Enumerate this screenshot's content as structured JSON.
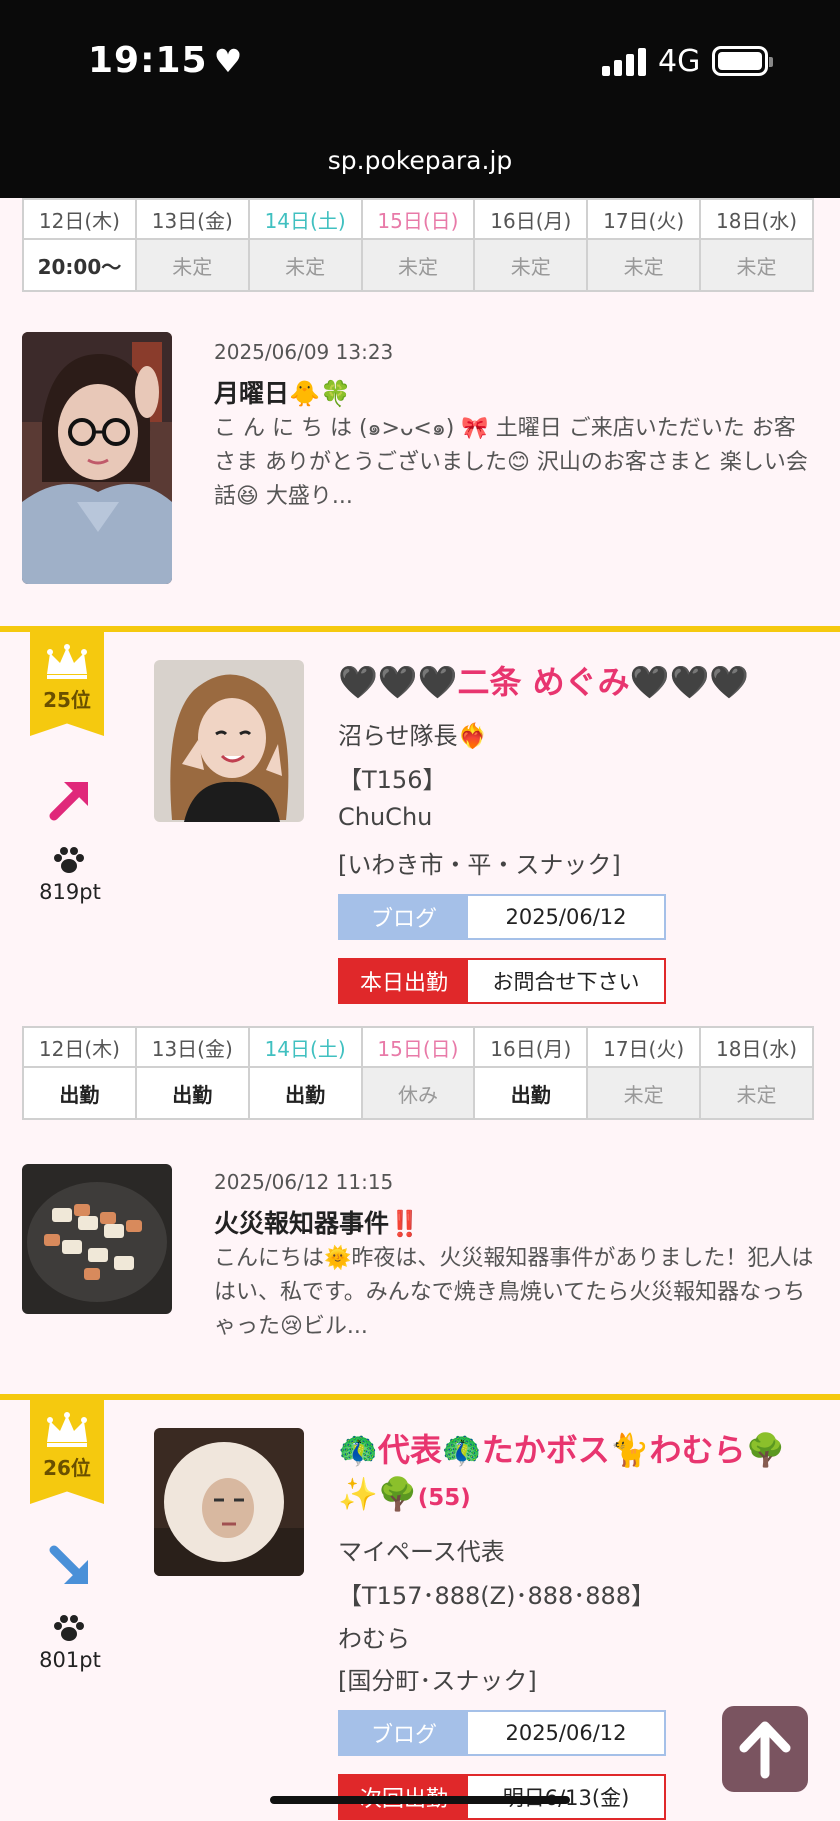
{
  "status_bar": {
    "time": "19:15",
    "network": "4G",
    "url": "sp.pokepara.jp"
  },
  "days": [
    {
      "label": "12日(木)",
      "kind": "wd"
    },
    {
      "label": "13日(金)",
      "kind": "wd"
    },
    {
      "label": "14日(土)",
      "kind": "sat"
    },
    {
      "label": "15日(日)",
      "kind": "sun"
    },
    {
      "label": "16日(月)",
      "kind": "wd"
    },
    {
      "label": "17日(火)",
      "kind": "wd"
    },
    {
      "label": "18日(水)",
      "kind": "wd"
    }
  ],
  "schedule_top": [
    "20:00〜",
    "未定",
    "未定",
    "未定",
    "未定",
    "未定",
    "未定"
  ],
  "blog1": {
    "date": "2025/06/09 13:23",
    "title": "月曜日🐥🍀",
    "excerpt": "こ ん に ち は (๑>ᴗ<๑) 🎀 土曜日 ご来店いただいた お客さま ありがとうございました😊 沢山のお客さまと 楽しい会話😆 大盛り..."
  },
  "cast1": {
    "rank": "25位",
    "trend": "up",
    "points": "819pt",
    "name_prefix": "🖤🖤🖤",
    "name": "二条 めぐみ",
    "name_suffix": "🖤🖤🖤",
    "catch": "沼らせ隊長❤️‍🔥",
    "spec": "【T156】",
    "shop": "ChuChu",
    "area": "[いわき市・平・スナック]",
    "blog_label": "ブログ",
    "blog_date": "2025/06/12",
    "attend_label": "本日出勤",
    "attend_value": "お問合せ下さい",
    "schedule": [
      "出勤",
      "出勤",
      "出勤",
      "休み",
      "出勤",
      "未定",
      "未定"
    ]
  },
  "blog2": {
    "date": "2025/06/12 11:15",
    "title": "火災報知器事件‼️",
    "excerpt": "こんにちは🌞昨夜は、火災報知器事件がありました！犯人ははい、私です。みんなで焼き鳥焼いてたら火災報知器なっちゃった😢ビル..."
  },
  "cast2": {
    "rank": "26位",
    "trend": "down",
    "points": "801pt",
    "name": "🦚代表🦚たかボス🐈わむら🌳✨🌳",
    "age": "(55)",
    "catch": "マイペース代表",
    "spec": "【T157･888(Z)･888･888】",
    "shop": "わむら",
    "area": "[国分町･スナック]",
    "blog_label": "ブログ",
    "blog_date": "2025/06/12",
    "attend_label": "次回出勤",
    "attend_value": "明日6/13(金)"
  },
  "colors": {
    "accent_pink": "#e8356f",
    "rank_gold": "#f5c90f",
    "blog_blue": "#a5c0e8",
    "attend_red": "#e0282a"
  },
  "icons": [
    "heart-icon",
    "signal-icon",
    "battery-icon",
    "crown-icon",
    "up-arrow-icon",
    "down-arrow-icon",
    "paw-icon",
    "back-to-top-icon"
  ]
}
